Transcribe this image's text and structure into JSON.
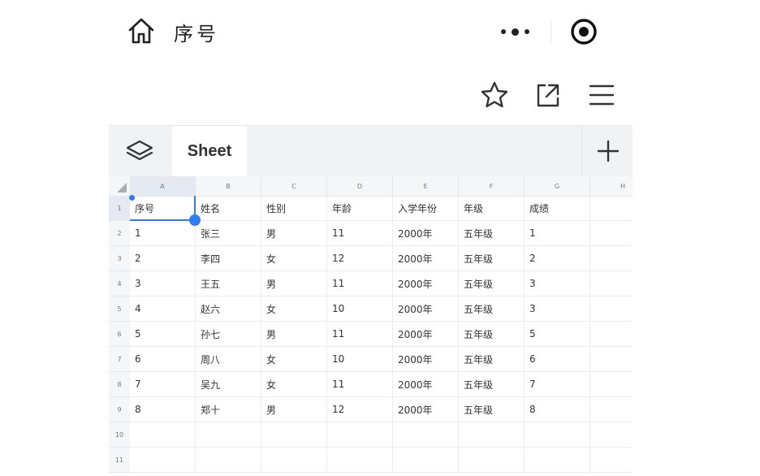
{
  "topbar": {
    "title": "序号",
    "home_icon": "home-icon",
    "more_icon": "more-dots-icon",
    "close_icon": "target-close-icon"
  },
  "toolbar": {
    "icons": [
      "star-icon",
      "share-icon",
      "menu-icon"
    ]
  },
  "tabs": {
    "active_sheet": "Sheet",
    "layers_icon": "layers-icon",
    "add_icon": "plus-icon"
  },
  "grid": {
    "columns": [
      "A",
      "B",
      "C",
      "D",
      "E",
      "F",
      "G",
      "H"
    ],
    "rows": [
      {
        "num": "1",
        "cells": [
          "序号",
          "姓名",
          "性别",
          "年龄",
          "入学年份",
          "年级",
          "成绩"
        ]
      },
      {
        "num": "2",
        "cells": [
          "1",
          "张三",
          "男",
          "11",
          "2000年",
          "五年级",
          "1"
        ]
      },
      {
        "num": "3",
        "cells": [
          "2",
          "李四",
          "女",
          "12",
          "2000年",
          "五年级",
          "2"
        ]
      },
      {
        "num": "4",
        "cells": [
          "3",
          "王五",
          "男",
          "11",
          "2000年",
          "五年级",
          "3"
        ]
      },
      {
        "num": "5",
        "cells": [
          "4",
          "赵六",
          "女",
          "10",
          "2000年",
          "五年级",
          "3"
        ]
      },
      {
        "num": "6",
        "cells": [
          "5",
          "孙七",
          "男",
          "11",
          "2000年",
          "五年级",
          "5"
        ]
      },
      {
        "num": "7",
        "cells": [
          "6",
          "周八",
          "女",
          "10",
          "2000年",
          "五年级",
          "6"
        ]
      },
      {
        "num": "8",
        "cells": [
          "7",
          "吴九",
          "女",
          "11",
          "2000年",
          "五年级",
          "7"
        ]
      },
      {
        "num": "9",
        "cells": [
          "8",
          "郑十",
          "男",
          "12",
          "2000年",
          "五年级",
          "8"
        ]
      },
      {
        "num": "10",
        "cells": [
          "",
          "",
          "",
          "",
          "",
          "",
          ""
        ]
      },
      {
        "num": "11",
        "cells": [
          "",
          "",
          "",
          "",
          "",
          "",
          ""
        ]
      }
    ]
  },
  "colors": {
    "accent": "#2f7cf6",
    "header_bg": "#f5f6f7",
    "tabbar_bg": "#f1f2f4"
  }
}
